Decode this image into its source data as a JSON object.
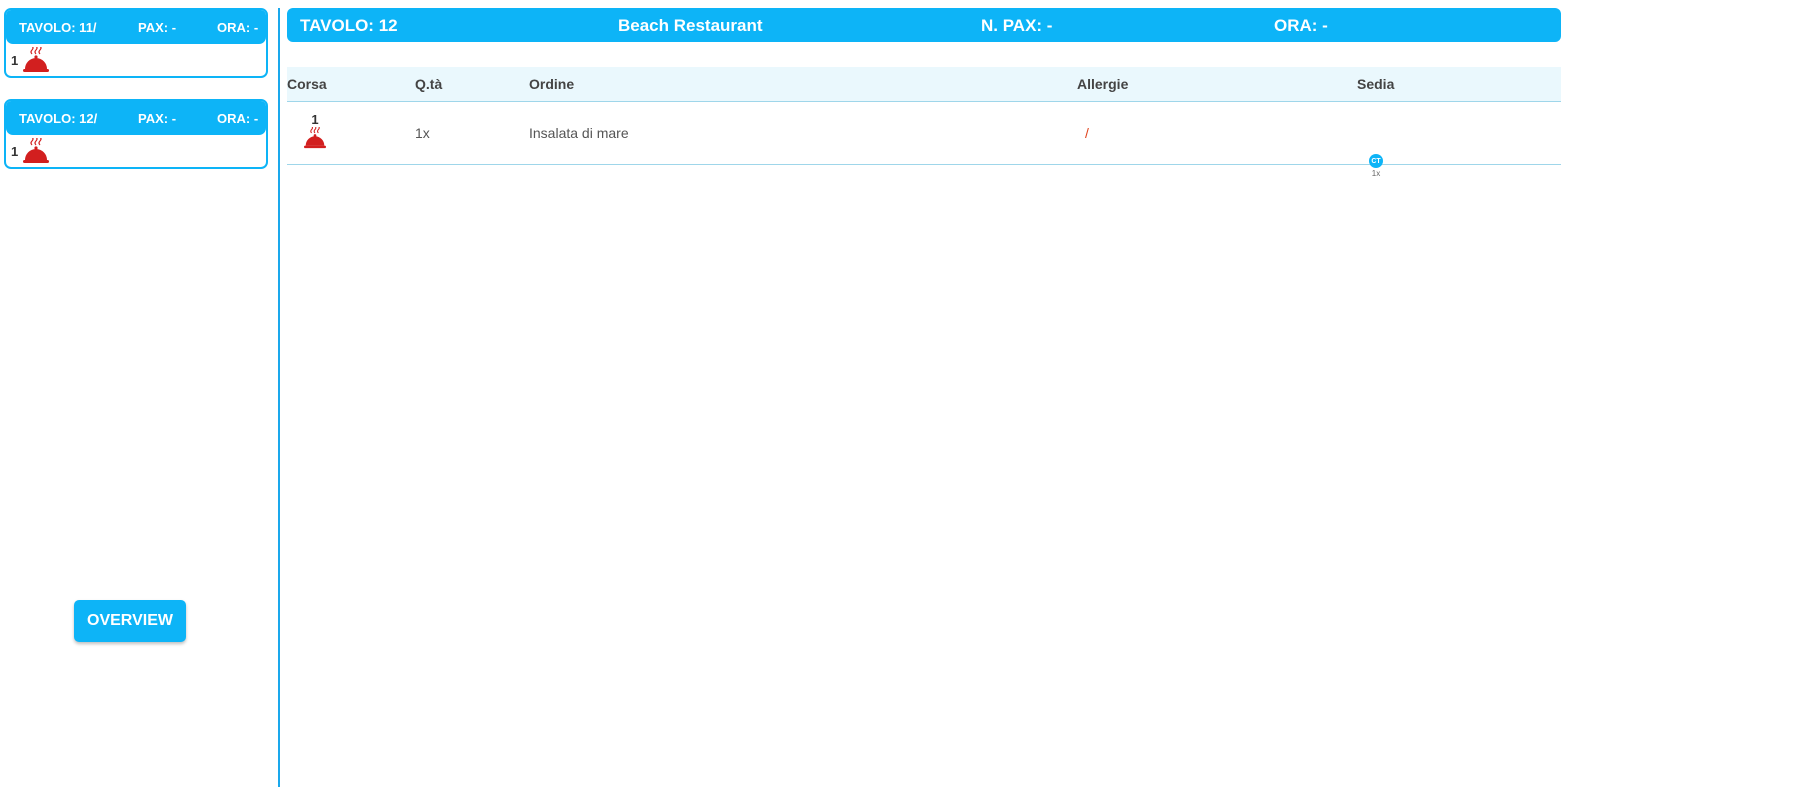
{
  "sidebar": {
    "tables": [
      {
        "table": "TAVOLO: 11/",
        "pax": "PAX: -",
        "time": "ORA: -",
        "course": "1",
        "icon": "cloche-icon"
      },
      {
        "table": "TAVOLO: 12/",
        "pax": "PAX: -",
        "time": "ORA: -",
        "course": "1",
        "icon": "cloche-icon"
      }
    ],
    "overview_label": "OVERVIEW"
  },
  "header": {
    "table": "TAVOLO: 12",
    "restaurant": "Beach Restaurant",
    "pax": "N. PAX: -",
    "time": "ORA: -"
  },
  "order_table": {
    "columns": [
      "Corsa",
      "Q.tà",
      "Ordine",
      "Allergie",
      "Sedia"
    ],
    "rows": [
      {
        "course": "1",
        "qty": "1x",
        "item": "Insalata di mare",
        "allergies": "/",
        "chair": "CT",
        "chair_qty": "1x"
      }
    ]
  },
  "colors": {
    "accent": "#0db4f7",
    "icon_red": "#d21f1f",
    "allergy": "#e0431c",
    "header_bg": "#eaf8fd"
  }
}
